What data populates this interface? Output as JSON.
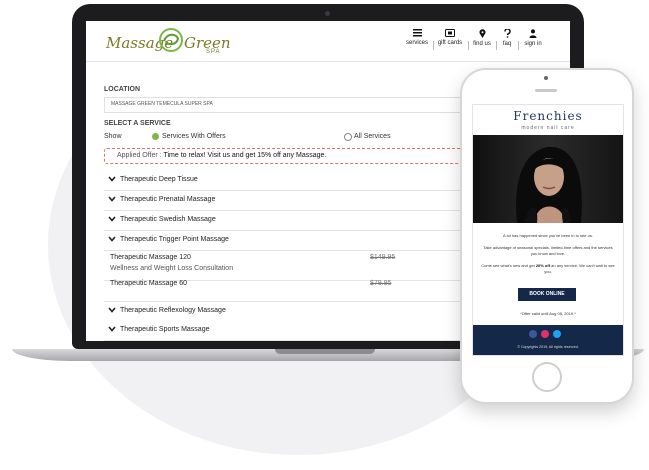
{
  "site": {
    "logo_left": "Massage",
    "logo_right": "Green",
    "logo_sub": "SPA"
  },
  "nav": [
    {
      "label": "services",
      "icon": "menu-icon"
    },
    {
      "label": "gift cards",
      "icon": "gift-card-icon"
    },
    {
      "label": "find us",
      "icon": "location-pin-icon"
    },
    {
      "label": "faq",
      "icon": "question-icon"
    },
    {
      "label": "sign in",
      "icon": "user-icon"
    }
  ],
  "form": {
    "location_label": "LOCATION",
    "location_value": "MASSAGE GREEN TEMECULA SUPER SPA",
    "service_label": "SELECT A SERVICE",
    "show_label": "Show",
    "radio_offers": "Services With Offers",
    "radio_all": "All Services",
    "offer_prefix": "Applied Offer :",
    "offer_text": "Time to relax! Visit us and get 15% off any Massage."
  },
  "accordions_top": [
    "Therapeutic Deep Tissue",
    "Therapeutic Prenatal Massage",
    "Therapeutic Swedish Massage",
    "Therapeutic Trigger Point Massage"
  ],
  "services": [
    {
      "name": "Therapeutic Massage 120",
      "sub": "Wellness and Weight Loss Consultation",
      "price": "$149.95"
    },
    {
      "name": "Therapeutic Massage 60",
      "sub": "",
      "price": "$79.95"
    }
  ],
  "accordions_bottom": [
    "Therapeutic Reflexology Massage",
    "Therapeutic Sports Massage"
  ],
  "phone": {
    "brand": "Frenchies",
    "brand_sub": "modern nail care",
    "copy1": "A lot has happened since you've been in to see us.",
    "copy2": "Take advantage of seasonal specials, limited-time offers and the services you know and love.",
    "copy3_pre": "Come see what's new and get",
    "copy3_bold": "20% off",
    "copy3_post": "an any service. We can't wait to see you.",
    "button": "BOOK ONLINE",
    "valid": "*Offer valid until Aug 05, 2019.*",
    "footer": "© Copyrights 2019, All rights reserved.",
    "colors": {
      "navy": "#14294a",
      "facebook": "#3b5998",
      "instagram": "#e1306c",
      "twitter": "#1da1f2"
    }
  }
}
